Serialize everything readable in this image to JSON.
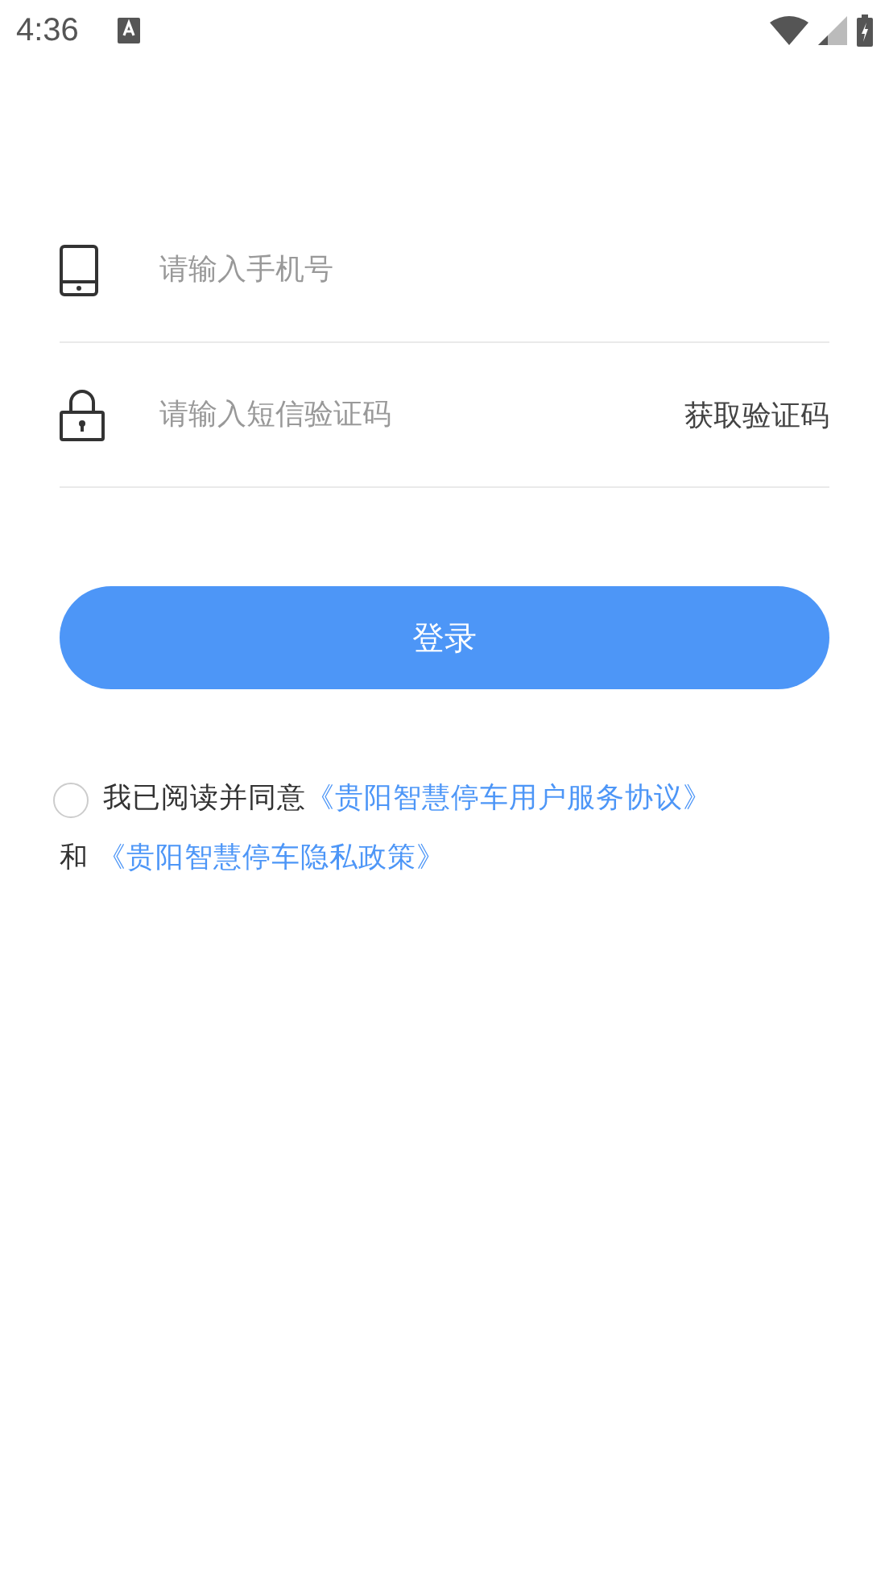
{
  "status_bar": {
    "time": "4:36"
  },
  "phone_field": {
    "placeholder": "请输入手机号"
  },
  "code_field": {
    "placeholder": "请输入短信验证码",
    "action": "获取验证码"
  },
  "login_button": {
    "label": "登录"
  },
  "agreement": {
    "agreed": false,
    "prefix": "我已阅读并同意",
    "terms_link": "《贵阳智慧停车用户服务协议》",
    "joiner": "和",
    "privacy_link": "《贵阳智慧停车隐私政策》"
  }
}
